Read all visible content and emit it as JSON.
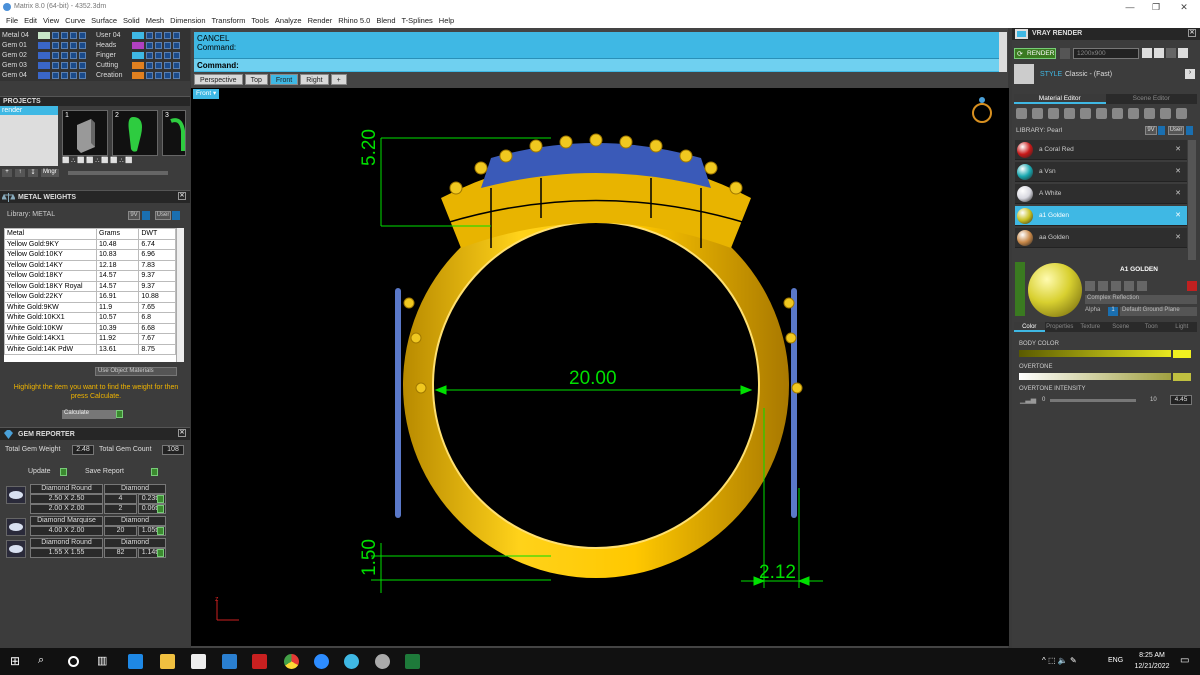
{
  "window": {
    "title": "Matrix 8.0 (64-bit) - 4352.3dm"
  },
  "menu": [
    "File",
    "Edit",
    "View",
    "Curve",
    "Surface",
    "Solid",
    "Mesh",
    "Dimension",
    "Transform",
    "Tools",
    "Analyze",
    "Render",
    "Rhino 5.0",
    "Blend",
    "T-Splines",
    "Help"
  ],
  "layers": {
    "left": [
      {
        "label": "Metal 04",
        "color": "#c8e6c8"
      },
      {
        "label": "Gem 01",
        "color": "#3a66c8"
      },
      {
        "label": "Gem 02",
        "color": "#3a66c8"
      },
      {
        "label": "Gem 03",
        "color": "#3a66c8"
      },
      {
        "label": "Gem 04",
        "color": "#3a66c8"
      }
    ],
    "right": [
      {
        "label": "User 04",
        "color": "#3fb8e4"
      },
      {
        "label": "Heads",
        "color": "#b040c0"
      },
      {
        "label": "Finger",
        "color": "#3fb8e4"
      },
      {
        "label": "Cutting",
        "color": "#e08020"
      },
      {
        "label": "Creation",
        "color": "#e08020"
      }
    ]
  },
  "projects": {
    "title": "PROJECTS",
    "list_item": "render",
    "thumbs": [
      "1",
      "2",
      "3"
    ],
    "mngr_label": "Mngr"
  },
  "metal_weights": {
    "title": "METAL WEIGHTS",
    "library_label": "Library: METAL",
    "lib_btn1": "9V",
    "lib_btn2": "User",
    "columns": [
      "Metal",
      "Grams",
      "DWT"
    ],
    "rows": [
      [
        "Yellow Gold:9KY",
        "10.48",
        "6.74"
      ],
      [
        "Yellow Gold:10KY",
        "10.83",
        "6.96"
      ],
      [
        "Yellow Gold:14KY",
        "12.18",
        "7.83"
      ],
      [
        "Yellow Gold:18KY",
        "14.57",
        "9.37"
      ],
      [
        "Yellow Gold:18KY Royal",
        "14.57",
        "9.37"
      ],
      [
        "Yellow Gold:22KY",
        "16.91",
        "10.88"
      ],
      [
        "White Gold:9KW",
        "11.9",
        "7.65"
      ],
      [
        "White Gold:10KX1",
        "10.57",
        "6.8"
      ],
      [
        "White Gold:10KW",
        "10.39",
        "6.68"
      ],
      [
        "White Gold:14KX1",
        "11.92",
        "7.67"
      ],
      [
        "White Gold:14K PdW",
        "13.61",
        "8.75"
      ]
    ],
    "use_object_materials": "Use Object Materials",
    "hint": "Highlight the item you want to find the weight for then press Calculate.",
    "calculate": "Calculate"
  },
  "gem_reporter": {
    "title": "GEM REPORTER",
    "total_weight_label": "Total Gem Weight",
    "total_weight": "2.48",
    "total_count_label": "Total Gem Count",
    "total_count": "108",
    "update": "Update",
    "save_report": "Save Report",
    "groups": [
      {
        "shape": "Diamond Round",
        "material": "Diamond",
        "rows": [
          [
            "2.50 X 2.50",
            "4",
            "0.23tw"
          ],
          [
            "2.00 X 2.00",
            "2",
            "0.06tw"
          ]
        ]
      },
      {
        "shape": "Diamond Marquise",
        "material": "Diamond",
        "rows": [
          [
            "4.00 X 2.00",
            "20",
            "1.05tw"
          ]
        ]
      },
      {
        "shape": "Diamond Round",
        "material": "Diamond",
        "rows": [
          [
            "1.55 X 1.55",
            "82",
            "1.14tw"
          ]
        ]
      }
    ]
  },
  "command": {
    "line1": "CANCEL",
    "line2": "Command:",
    "prompt": "Command:"
  },
  "view_tabs": [
    "Perspective",
    "Top",
    "Front",
    "Right",
    "+"
  ],
  "active_tab": "Front",
  "viewport": {
    "label": "Front",
    "dims": {
      "height": "5.20",
      "width": "20.00",
      "band": "1.50",
      "band_width": "2.12"
    },
    "axis": "z"
  },
  "vray": {
    "title": "VRAY RENDER",
    "render_btn": "RENDER",
    "resolution": "1200x900",
    "style_label": "STYLE",
    "style_value": "Classic - (Fast)",
    "tabs": [
      "Material Editor",
      "Scene Editor"
    ],
    "library_label": "LIBRARY: Pearl",
    "lib_btn1": "9V",
    "lib_btn2": "User",
    "materials": [
      {
        "name": "a Coral Red",
        "color": "#c81818"
      },
      {
        "name": "a Vsn",
        "color": "#18a8b0"
      },
      {
        "name": "A White",
        "color": "#d8d8e0"
      },
      {
        "name": "a1 Golden",
        "color": "#c8c020"
      },
      {
        "name": "aa Golden",
        "color": "#c88848"
      }
    ],
    "selected_material": "A1 GOLDEN",
    "reflection": "Complex Reflection",
    "alpha_label": "Alpha",
    "alpha_value": "1",
    "ground": "Default Ground Plane",
    "prop_tabs": [
      "Color",
      "Properties",
      "Texture",
      "Scene",
      "Toon",
      "Light"
    ],
    "body_color_label": "BODY COLOR",
    "overtone_label": "OVERTONE",
    "overtone_intensity_label": "OVERTONE INTENSITY",
    "intensity_min": "0",
    "intensity_max": "10",
    "intensity_value": "4.45"
  },
  "taskbar": {
    "time": "8:25 AM",
    "date": "12/21/2022",
    "lang": "ENG"
  }
}
